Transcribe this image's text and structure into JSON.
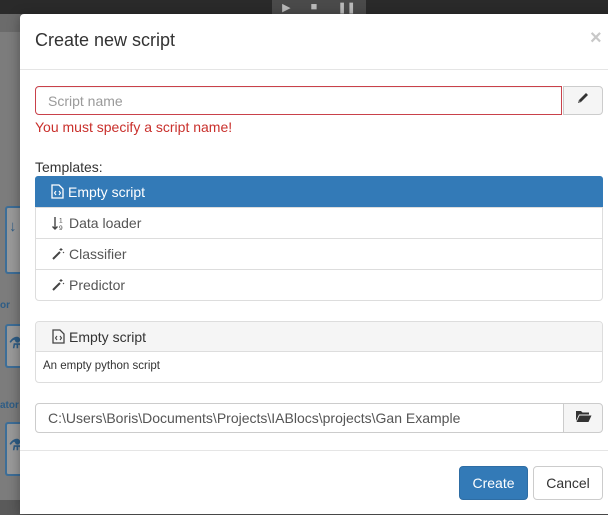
{
  "dialog": {
    "title": "Create new script",
    "close_label": "×"
  },
  "name_field": {
    "placeholder": "Script name",
    "value": "",
    "error": "You must specify a script name!",
    "edit_icon": "pencil-icon"
  },
  "templates": {
    "label": "Templates:",
    "items": [
      {
        "label": "Empty script",
        "icon": "code-file-icon",
        "selected": true
      },
      {
        "label": "Data loader",
        "icon": "sort-numeric-icon",
        "selected": false
      },
      {
        "label": "Classifier",
        "icon": "magic-wand-icon",
        "selected": false
      },
      {
        "label": "Predictor",
        "icon": "magic-wand-icon",
        "selected": false
      }
    ]
  },
  "preview": {
    "title": "Empty script",
    "icon": "code-file-icon",
    "description": "An empty python script"
  },
  "path_field": {
    "value": "C:\\Users\\Boris\\Documents\\Projects\\IABlocs\\projects\\Gan Example",
    "browse_icon": "folder-open-icon"
  },
  "footer": {
    "create_label": "Create",
    "cancel_label": "Cancel"
  },
  "background": {
    "labels": [
      "or",
      "ator"
    ]
  },
  "colors": {
    "primary": "#337ab7",
    "error": "#c9302c"
  }
}
